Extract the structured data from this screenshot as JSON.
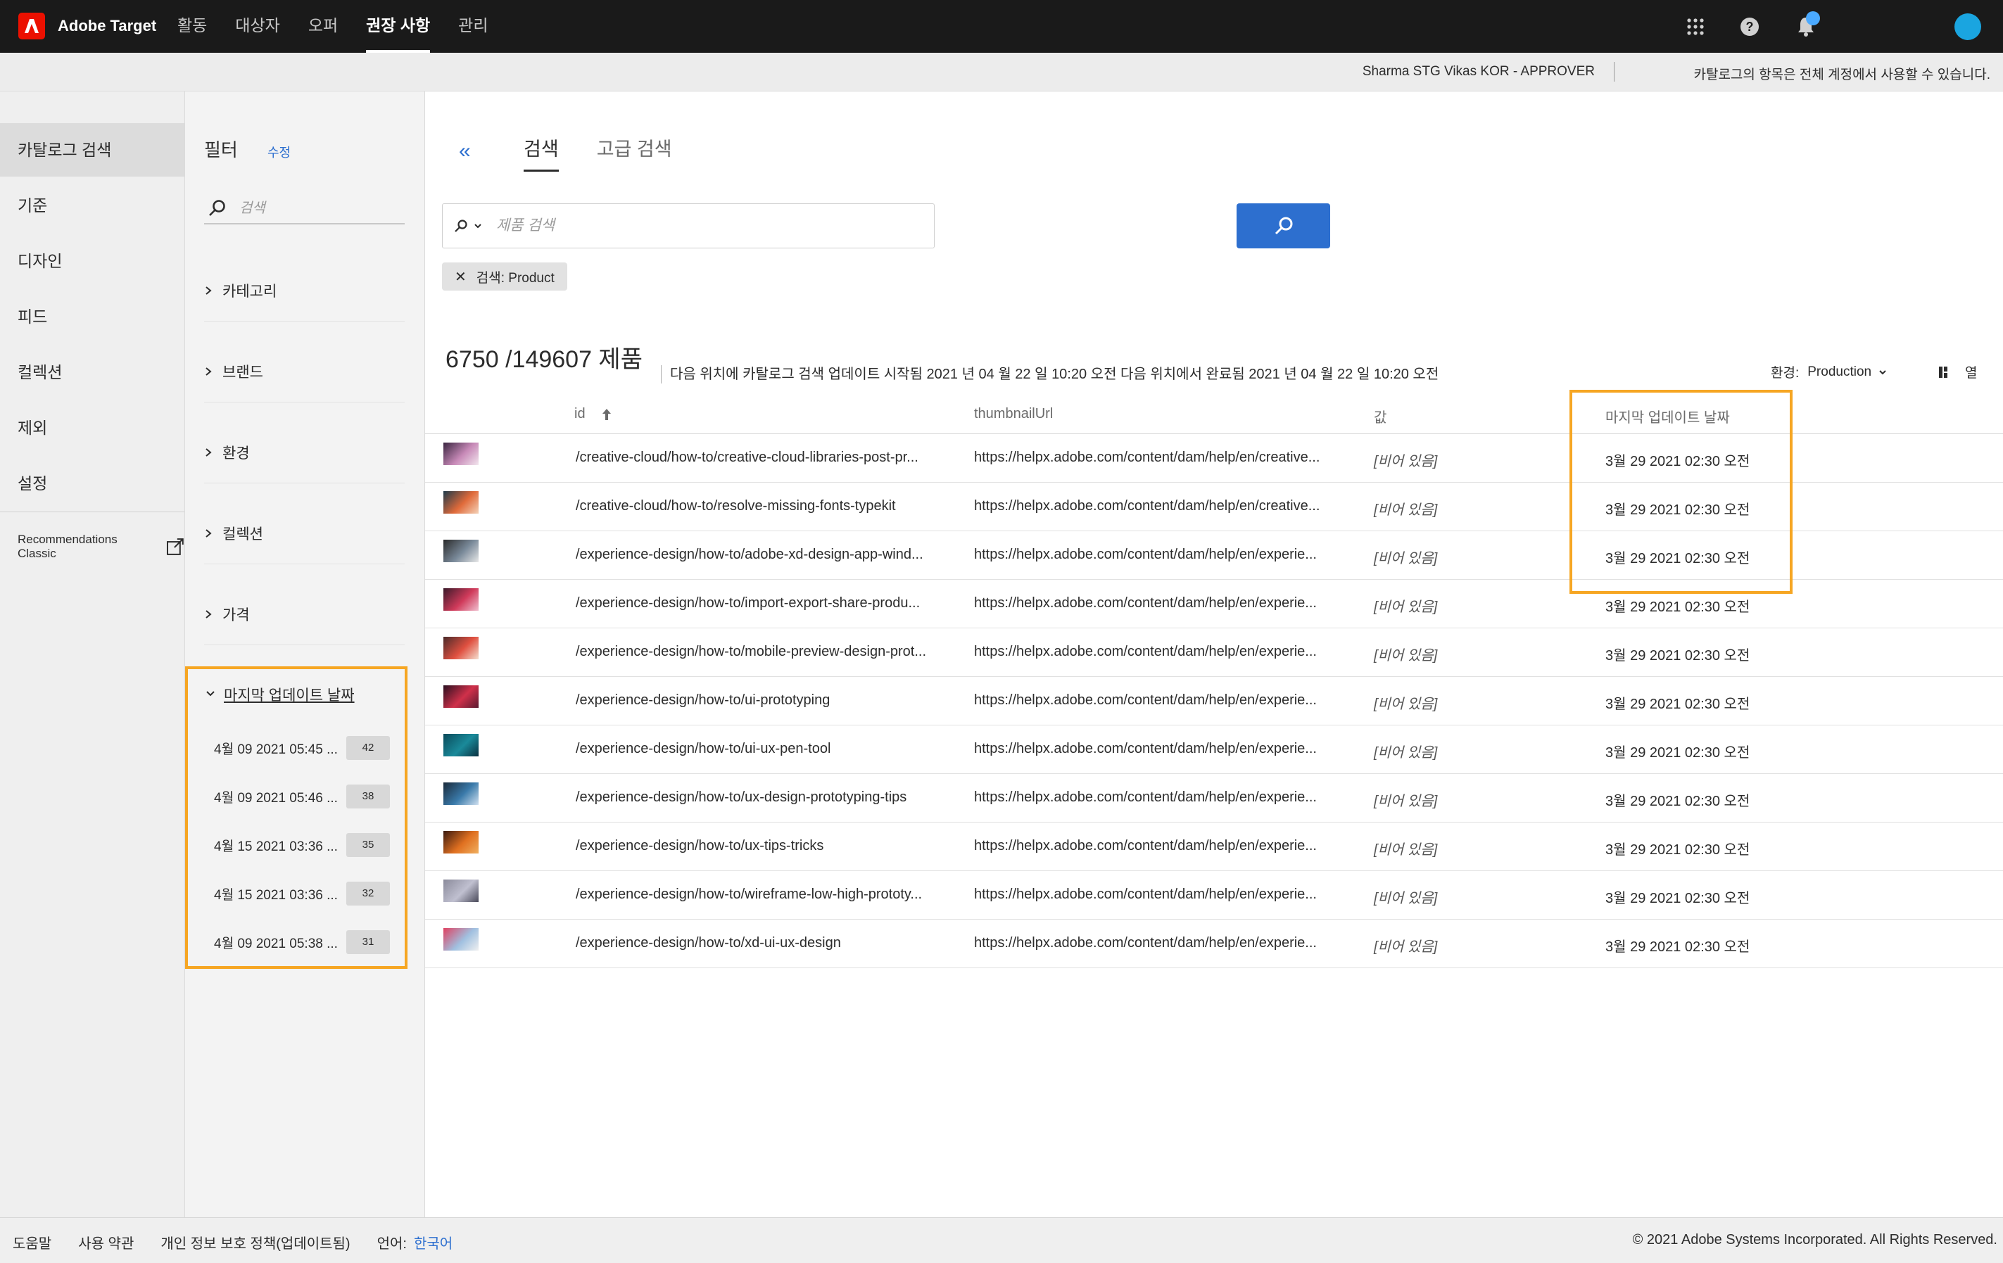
{
  "app": {
    "name": "Adobe Target"
  },
  "topnav": [
    {
      "label": "활동",
      "active": false
    },
    {
      "label": "대상자",
      "active": false
    },
    {
      "label": "오퍼",
      "active": false
    },
    {
      "label": "권장 사항",
      "active": true
    },
    {
      "label": "관리",
      "active": false
    }
  ],
  "topbar_icons": [
    "apps-grid-icon",
    "help-icon",
    "notifications-icon",
    "user-avatar"
  ],
  "subheader": {
    "user": "Sharma STG Vikas KOR - APPROVER",
    "note": "카탈로그의 항목은 전체 계정에서 사용할 수 있습니다."
  },
  "leftnav": {
    "items": [
      {
        "label": "카탈로그 검색",
        "active": true
      },
      {
        "label": "기준",
        "active": false
      },
      {
        "label": "디자인",
        "active": false
      },
      {
        "label": "피드",
        "active": false
      },
      {
        "label": "컬렉션",
        "active": false
      },
      {
        "label": "제외",
        "active": false
      },
      {
        "label": "설정",
        "active": false
      }
    ],
    "classic": "Recommendations Classic"
  },
  "filters": {
    "title": "필터",
    "edit": "수정",
    "search_placeholder": "검색",
    "facets": [
      "카테고리",
      "브랜드",
      "환경",
      "컬렉션",
      "가격"
    ],
    "date_facet": {
      "title": "마지막 업데이트 날짜",
      "rows": [
        {
          "date": "4월 09 2021 05:45 ...",
          "count": "42"
        },
        {
          "date": "4월 09 2021 05:46 ...",
          "count": "38"
        },
        {
          "date": "4월 15 2021 03:36 ...",
          "count": "35"
        },
        {
          "date": "4월 15 2021 03:36 ...",
          "count": "32"
        },
        {
          "date": "4월 09 2021 05:38 ...",
          "count": "31"
        }
      ]
    }
  },
  "main": {
    "collapse": "«",
    "tabs": [
      {
        "label": "검색",
        "active": true
      },
      {
        "label": "고급 검색",
        "active": false
      }
    ],
    "search_placeholder": "제품 검색",
    "tag": "검색: Product",
    "summary": "6750 /149607 제품",
    "status": "다음 위치에 카탈로그 검색 업데이트 시작됨 2021 년 04 월 22 일 10:20 오전 다음 위치에서 완료됨 2021 년 04 월 22 일 10:20 오전",
    "env_label": "환경:",
    "env_value": "Production",
    "columns_button": "열"
  },
  "table": {
    "headers": {
      "id": "id",
      "thumbnail": "thumbnailUrl",
      "value": "값",
      "updated": "마지막 업데이트 날짜"
    },
    "rows": [
      {
        "id": "/creative-cloud/how-to/creative-cloud-libraries-post-pr...",
        "url": "https://helpx.adobe.com/content/dam/help/en/creative...",
        "value": "[비어 있음]",
        "updated": "3월 29 2021 02:30 오전",
        "thumb": [
          "#3a2540",
          "#c88ab8",
          "#f2e6ee"
        ]
      },
      {
        "id": "/creative-cloud/how-to/resolve-missing-fonts-typekit",
        "url": "https://helpx.adobe.com/content/dam/help/en/creative...",
        "value": "[비어 있음]",
        "updated": "3월 29 2021 02:30 오전",
        "thumb": [
          "#1d3a4a",
          "#e06a3a",
          "#f4d2b8"
        ]
      },
      {
        "id": "/experience-design/how-to/adobe-xd-design-app-wind...",
        "url": "https://helpx.adobe.com/content/dam/help/en/experie...",
        "value": "[비어 있음]",
        "updated": "3월 29 2021 02:30 오전",
        "thumb": [
          "#2a2a2a",
          "#7a8a9a",
          "#e8e8e8"
        ]
      },
      {
        "id": "/experience-design/how-to/import-export-share-produ...",
        "url": "https://helpx.adobe.com/content/dam/help/en/experie...",
        "value": "[비어 있음]",
        "updated": "3월 29 2021 02:30 오전",
        "thumb": [
          "#3a1a2a",
          "#d03a5a",
          "#f0c0d0"
        ]
      },
      {
        "id": "/experience-design/how-to/mobile-preview-design-prot...",
        "url": "https://helpx.adobe.com/content/dam/help/en/experie...",
        "value": "[비어 있음]",
        "updated": "3월 29 2021 02:30 오전",
        "thumb": [
          "#4a2a2a",
          "#e05040",
          "#f4e0d0"
        ]
      },
      {
        "id": "/experience-design/how-to/ui-prototyping",
        "url": "https://helpx.adobe.com/content/dam/help/en/experie...",
        "value": "[비어 있음]",
        "updated": "3월 29 2021 02:30 오전",
        "thumb": [
          "#2a1020",
          "#d0304a",
          "#5a1a30"
        ]
      },
      {
        "id": "/experience-design/how-to/ui-ux-pen-tool",
        "url": "https://helpx.adobe.com/content/dam/help/en/experie...",
        "value": "[비어 있음]",
        "updated": "3월 29 2021 02:30 오전",
        "thumb": [
          "#0a4a5a",
          "#1a8a9a",
          "#0a3040"
        ]
      },
      {
        "id": "/experience-design/how-to/ux-design-prototyping-tips",
        "url": "https://helpx.adobe.com/content/dam/help/en/experie...",
        "value": "[비어 있음]",
        "updated": "3월 29 2021 02:30 오전",
        "thumb": [
          "#1a2a3a",
          "#3a7aaa",
          "#d0e0f0"
        ]
      },
      {
        "id": "/experience-design/how-to/ux-tips-tricks",
        "url": "https://helpx.adobe.com/content/dam/help/en/experie...",
        "value": "[비어 있음]",
        "updated": "3월 29 2021 02:30 오전",
        "thumb": [
          "#3a1a10",
          "#e07020",
          "#f0b060"
        ]
      },
      {
        "id": "/experience-design/how-to/wireframe-low-high-prototy...",
        "url": "https://helpx.adobe.com/content/dam/help/en/experie...",
        "value": "[비어 있음]",
        "updated": "3월 29 2021 02:30 오전",
        "thumb": [
          "#8a8a9a",
          "#c0c0d0",
          "#4a4a5a"
        ]
      },
      {
        "id": "/experience-design/how-to/xd-ui-ux-design",
        "url": "https://helpx.adobe.com/content/dam/help/en/experie...",
        "value": "[비어 있음]",
        "updated": "3월 29 2021 02:30 오전",
        "thumb": [
          "#e04060",
          "#a0c0e0",
          "#f0f0f0"
        ]
      }
    ]
  },
  "footer": {
    "links": [
      "도움말",
      "사용 약관",
      "개인 정보 보호 정책(업데이트됨)",
      "언어:"
    ],
    "language": "한국어",
    "copyright": "© 2021 Adobe Systems Incorporated. All Rights Reserved."
  },
  "colors": {
    "accent": "#2d6fcf",
    "highlight": "#f6a623",
    "brand": "#eb1000",
    "topbar": "#1a1a1a"
  }
}
